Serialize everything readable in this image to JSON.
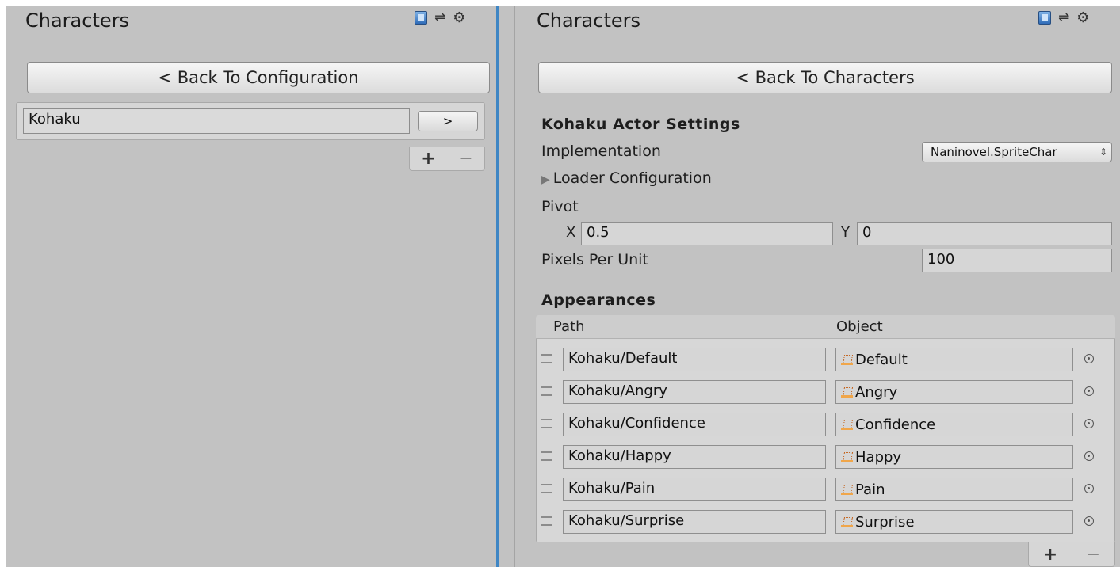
{
  "left_panel": {
    "title": "Characters",
    "back_button": "< Back To Configuration",
    "list": [
      {
        "name": "Kohaku",
        "open_label": ">"
      }
    ],
    "add_label": "+",
    "remove_label": "−"
  },
  "right_panel": {
    "title": "Characters",
    "back_button": "< Back To Characters",
    "section_title": "Kohaku Actor Settings",
    "implementation_label": "Implementation",
    "implementation_value": "Naninovel.SpriteChar",
    "loader_config_label": "Loader Configuration",
    "pivot_label": "Pivot",
    "pivot_x_label": "X",
    "pivot_x_value": "0.5",
    "pivot_y_label": "Y",
    "pivot_y_value": "0",
    "ppu_label": "Pixels Per Unit",
    "ppu_value": "100",
    "appearances_title": "Appearances",
    "columns": {
      "path": "Path",
      "object": "Object"
    },
    "appearances": [
      {
        "path": "Kohaku/Default",
        "object": "Default"
      },
      {
        "path": "Kohaku/Angry",
        "object": "Angry"
      },
      {
        "path": "Kohaku/Confidence",
        "object": "Confidence"
      },
      {
        "path": "Kohaku/Happy",
        "object": "Happy"
      },
      {
        "path": "Kohaku/Pain",
        "object": "Pain"
      },
      {
        "path": "Kohaku/Surprise",
        "object": "Surprise"
      }
    ],
    "add_label": "+",
    "remove_label": "−"
  },
  "colors": {
    "panel_bg": "#c2c2c2",
    "divider": "#3f86c4"
  }
}
